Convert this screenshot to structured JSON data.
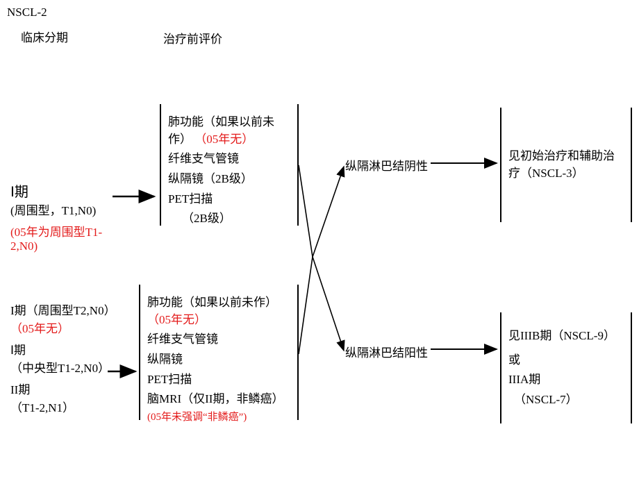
{
  "header": {
    "code": "NSCL-2",
    "col1_title": "临床分期",
    "col2_title": "治疗前评价"
  },
  "stageA": {
    "title": "Ⅰ期",
    "subtitle": "(周围型，T1,N0)",
    "note": "(05年为周围型T1-2,N0)"
  },
  "stageB": {
    "line1_a": "I期（周围型T2,N0）",
    "line1_note": "（05年无）",
    "line2_a": "Ⅰ期",
    "line2_b": "（中央型T1-2,N0）",
    "line3_a": "II期",
    "line3_b": "（T1-2,N1）"
  },
  "evalA": {
    "l1": "肺功能（如果以前未作）",
    "l1_note": "（05年无）",
    "l2": "纤维支气管镜",
    "l3": "纵隔镜（2B级）",
    "l4": "PET扫描",
    "l5": "（2B级）"
  },
  "evalB": {
    "l1": "肺功能（如果以前未作）",
    "l1_note": "（05年无）",
    "l2": "纤维支气管镜",
    "l3": "纵隔镜",
    "l4": "PET扫描",
    "l5": "脑MRI（仅II期，非鳞癌）",
    "l5_note": "(05年未强调“非鳞癌”)"
  },
  "branch": {
    "neg": "纵隔淋巴结阴性",
    "pos": "纵隔淋巴结阳性"
  },
  "outA": {
    "l1": "见初始治疗和辅助治疗（NSCL-3）"
  },
  "outB": {
    "l1": "见IIIB期（NSCL-9）",
    "l2": "或",
    "l3": "IIIA期",
    "l4": "（NSCL-7）"
  }
}
